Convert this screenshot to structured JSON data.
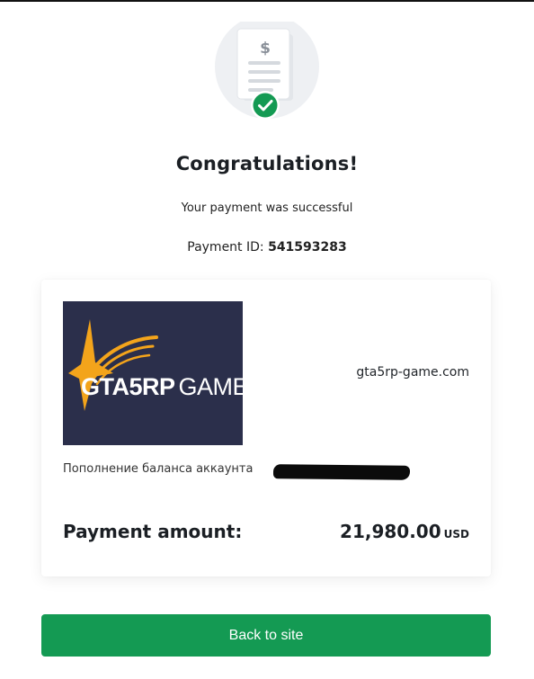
{
  "header": {
    "title": "Congratulations!",
    "subtitle": "Your payment was successful",
    "payment_id_label": "Payment ID:",
    "payment_id_value": "541593283"
  },
  "illustration": {
    "icons": [
      "receipt-icon",
      "dollar-sign-icon",
      "check-circle-icon"
    ],
    "dollar_symbol": "$",
    "check_color": "#149a53"
  },
  "merchant": {
    "logo_text_strong": "GTA5RP",
    "logo_text_light": "GAME",
    "logo_bg_color": "#2b2f4b",
    "logo_accent_color": "#f3a41b",
    "site": "gta5rp-game.com"
  },
  "order": {
    "description": "Пополнение баланса аккаунта"
  },
  "amount": {
    "label": "Payment amount:",
    "value": "21,980.00",
    "currency": "USD"
  },
  "actions": {
    "back_label": "Back to site",
    "button_color": "#149a53"
  }
}
